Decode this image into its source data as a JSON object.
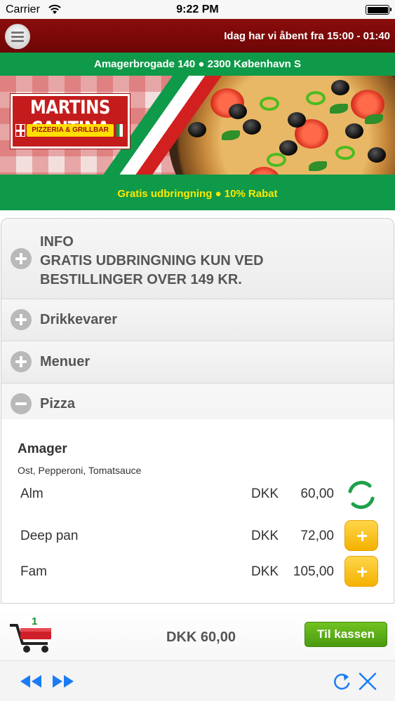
{
  "status_bar": {
    "carrier": "Carrier",
    "time": "9:22 PM"
  },
  "header": {
    "opening_hours": "Idag har vi åbent fra 15:00 - 01:40",
    "address": "Amagerbrogade 140 ● 2300 København S",
    "logo_title": "MARTINS CANTINA",
    "logo_subtitle": "PIZZERIA & GRILLBAR",
    "promo": "Gratis udbringning ● 10% Rabat"
  },
  "accordion": {
    "info_title": "INFO",
    "info_line1": "GRATIS UDBRINGNING KUN VED",
    "info_line2": "BESTILLINGER OVER 149 KR.",
    "drinks": "Drikkevarer",
    "menus": "Menuer",
    "pizza": "Pizza"
  },
  "product": {
    "name": "Amager",
    "description": "Ost, Pepperoni, Tomatsauce",
    "sizes": [
      {
        "label": "Alm",
        "currency": "DKK",
        "price": "60,00",
        "state": "loading"
      },
      {
        "label": "Deep pan",
        "currency": "DKK",
        "price": "72,00",
        "state": "add"
      },
      {
        "label": "Fam",
        "currency": "DKK",
        "price": "105,00",
        "state": "add"
      }
    ]
  },
  "cart": {
    "count": "1",
    "total": "DKK 60,00",
    "checkout_label": "Til kassen"
  },
  "colors": {
    "header_red": "#7d0a0a",
    "brand_green": "#0e9a49",
    "promo_yellow": "#ffe900",
    "add_button": "#f8c21a",
    "checkout_green": "#5aab17",
    "ios_blue": "#1a7cf5"
  },
  "icons": {
    "menu": "hamburger-menu-icon",
    "expand": "plus-circle-icon",
    "collapse": "minus-circle-icon",
    "add": "plus-icon",
    "loading": "spinner-icon",
    "cart": "shopping-cart-icon",
    "back": "rewind-icon",
    "forward": "fast-forward-icon",
    "reload": "reload-icon",
    "close": "close-icon"
  }
}
